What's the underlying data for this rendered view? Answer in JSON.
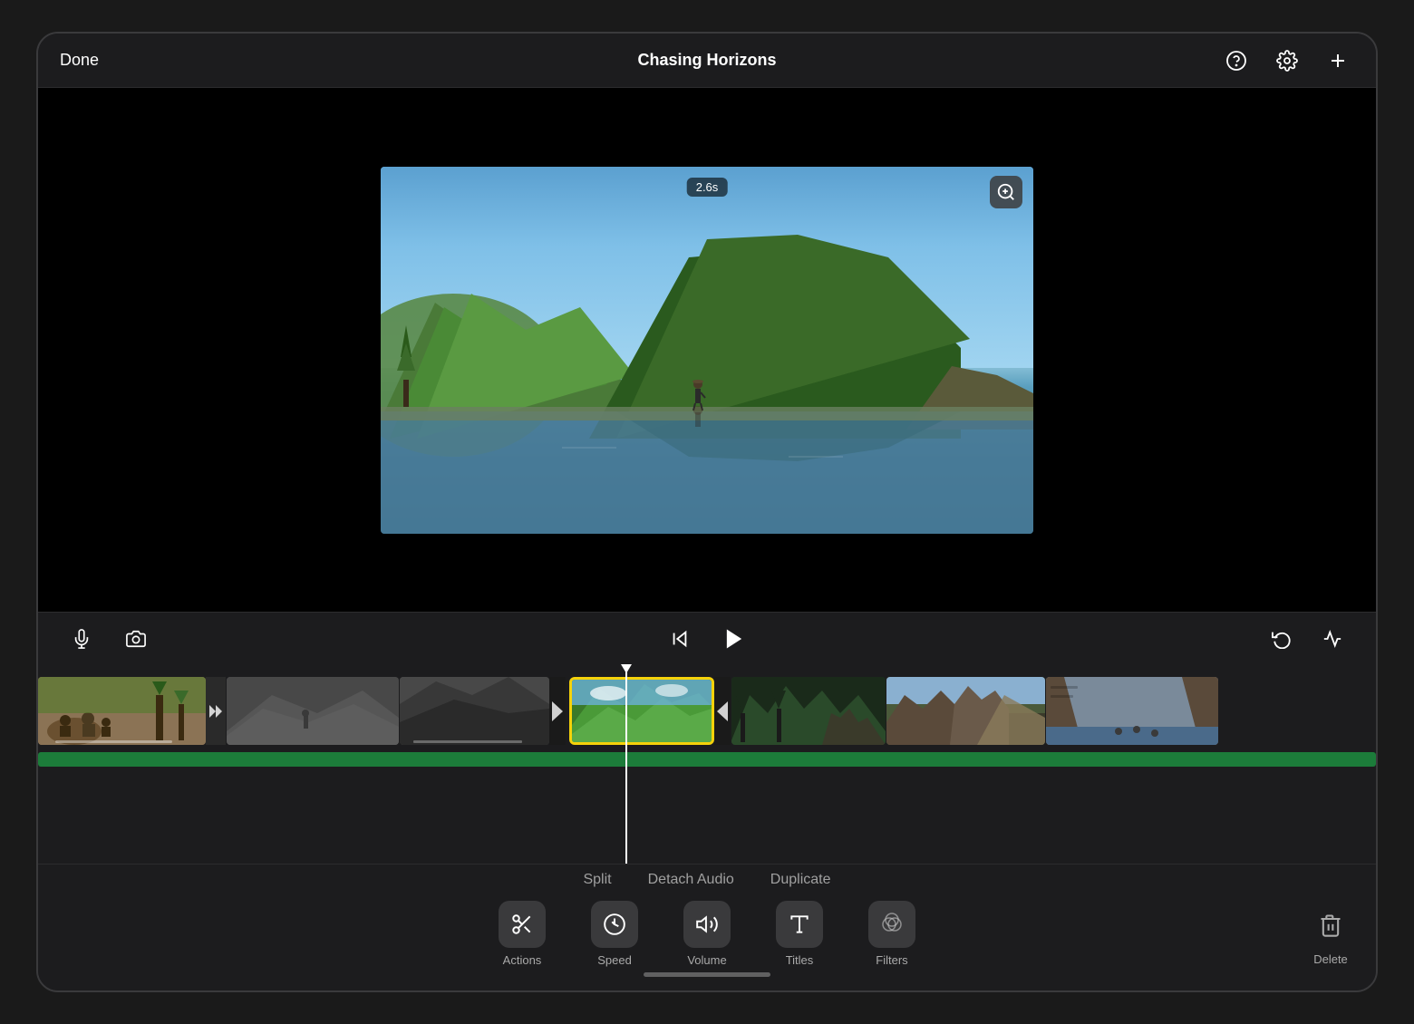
{
  "app": {
    "title": "Chasing Horizons"
  },
  "header": {
    "done_label": "Done",
    "title": "Chasing Horizons"
  },
  "header_icons": {
    "help": "?",
    "settings": "⚙",
    "add": "+"
  },
  "video": {
    "timestamp": "2.6s",
    "zoom_icon": "🔍"
  },
  "controls": {
    "mic_icon": "mic",
    "camera_icon": "camera",
    "skip_back_icon": "skip-back",
    "play_icon": "play",
    "undo_icon": "undo",
    "audio_icon": "audio-wave"
  },
  "context_menu": {
    "split": "Split",
    "detach_audio": "Detach Audio",
    "duplicate": "Duplicate"
  },
  "toolbar": {
    "actions_label": "Actions",
    "speed_label": "Speed",
    "volume_label": "Volume",
    "titles_label": "Titles",
    "filters_label": "Filters",
    "delete_label": "Delete"
  },
  "colors": {
    "accent": "#f5d20a",
    "audio_track": "#1c7c3a",
    "playhead": "#ffffff",
    "selected_clip_border": "#f5d20a"
  }
}
